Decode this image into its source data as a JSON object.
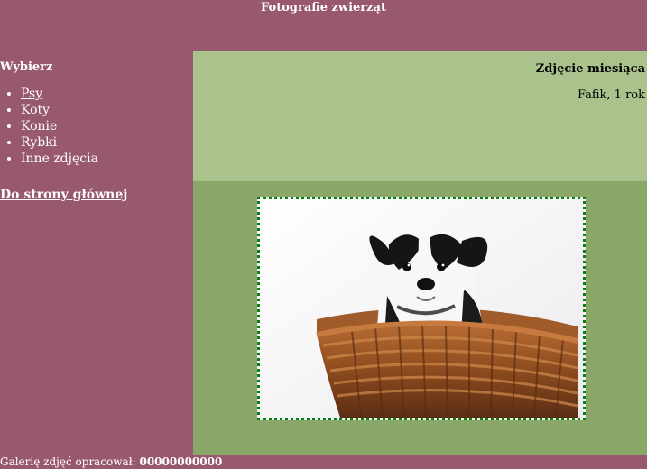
{
  "header": {
    "title": "Fotografie zwierząt"
  },
  "sidebar": {
    "heading": "Wybierz",
    "items": [
      {
        "label": "Psy"
      },
      {
        "label": "Koty"
      },
      {
        "label": "Konie"
      },
      {
        "label": "Rybki"
      },
      {
        "label": "Inne zdjęcia"
      }
    ],
    "home_link": "Do strony głównej"
  },
  "feature": {
    "title": "Zdjęcie miesiąca",
    "caption": "Fafik, 1 rok"
  },
  "footer": {
    "prefix": "Galerię zdjęć opracował:",
    "author": "00000000000"
  },
  "colors": {
    "page_background": "#98586f",
    "feature_panel": "#aac28b",
    "photo_panel": "#8aa769",
    "photo_border": "#0a7f14"
  }
}
